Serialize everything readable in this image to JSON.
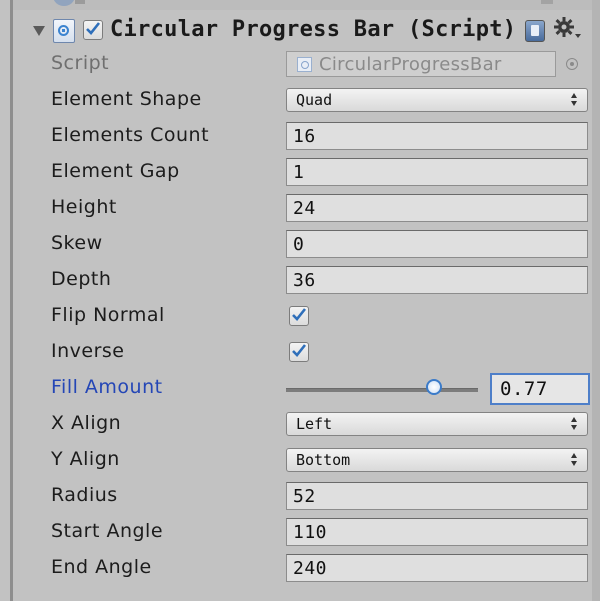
{
  "component": {
    "title": "Circular Progress Bar (Script)",
    "enabled": true,
    "icons": [
      "foldout-arrow-icon",
      "script-icon",
      "help-book-icon",
      "gear-icon"
    ]
  },
  "properties": {
    "script": {
      "label": "Script",
      "value": "CircularProgressBar"
    },
    "element_shape": {
      "label": "Element Shape",
      "value": "Quad"
    },
    "elements_count": {
      "label": "Elements Count",
      "value": "16"
    },
    "element_gap": {
      "label": "Element Gap",
      "value": "1"
    },
    "height": {
      "label": "Height",
      "value": "24"
    },
    "skew": {
      "label": "Skew",
      "value": "0"
    },
    "depth": {
      "label": "Depth",
      "value": "36"
    },
    "flip_normal": {
      "label": "Flip Normal",
      "checked": true
    },
    "inverse": {
      "label": "Inverse",
      "checked": true
    },
    "fill_amount": {
      "label": "Fill Amount",
      "value": "0.77",
      "slider_fraction": 0.77
    },
    "x_align": {
      "label": "X Align",
      "value": "Left"
    },
    "y_align": {
      "label": "Y Align",
      "value": "Bottom"
    },
    "radius": {
      "label": "Radius",
      "value": "52"
    },
    "start_angle": {
      "label": "Start Angle",
      "value": "110"
    },
    "end_angle": {
      "label": "End Angle",
      "value": "240"
    }
  },
  "colors": {
    "panel_background": "#c2c2c2",
    "focused_label": "#2446b6",
    "focus_outline": "#4e7fc9",
    "checkmark": "#2f6fba"
  }
}
